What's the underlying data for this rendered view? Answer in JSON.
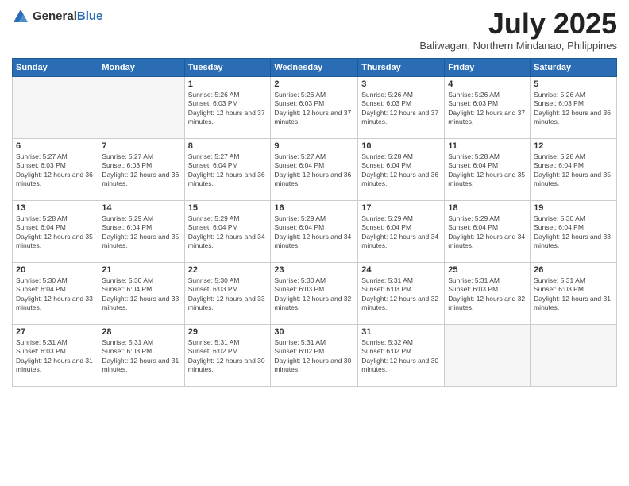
{
  "logo": {
    "general": "General",
    "blue": "Blue"
  },
  "title": {
    "month_year": "July 2025",
    "location": "Baliwagan, Northern Mindanao, Philippines"
  },
  "headers": [
    "Sunday",
    "Monday",
    "Tuesday",
    "Wednesday",
    "Thursday",
    "Friday",
    "Saturday"
  ],
  "weeks": [
    [
      {
        "num": "",
        "info": ""
      },
      {
        "num": "",
        "info": ""
      },
      {
        "num": "1",
        "info": "Sunrise: 5:26 AM\nSunset: 6:03 PM\nDaylight: 12 hours and 37 minutes."
      },
      {
        "num": "2",
        "info": "Sunrise: 5:26 AM\nSunset: 6:03 PM\nDaylight: 12 hours and 37 minutes."
      },
      {
        "num": "3",
        "info": "Sunrise: 5:26 AM\nSunset: 6:03 PM\nDaylight: 12 hours and 37 minutes."
      },
      {
        "num": "4",
        "info": "Sunrise: 5:26 AM\nSunset: 6:03 PM\nDaylight: 12 hours and 37 minutes."
      },
      {
        "num": "5",
        "info": "Sunrise: 5:26 AM\nSunset: 6:03 PM\nDaylight: 12 hours and 36 minutes."
      }
    ],
    [
      {
        "num": "6",
        "info": "Sunrise: 5:27 AM\nSunset: 6:03 PM\nDaylight: 12 hours and 36 minutes."
      },
      {
        "num": "7",
        "info": "Sunrise: 5:27 AM\nSunset: 6:03 PM\nDaylight: 12 hours and 36 minutes."
      },
      {
        "num": "8",
        "info": "Sunrise: 5:27 AM\nSunset: 6:04 PM\nDaylight: 12 hours and 36 minutes."
      },
      {
        "num": "9",
        "info": "Sunrise: 5:27 AM\nSunset: 6:04 PM\nDaylight: 12 hours and 36 minutes."
      },
      {
        "num": "10",
        "info": "Sunrise: 5:28 AM\nSunset: 6:04 PM\nDaylight: 12 hours and 36 minutes."
      },
      {
        "num": "11",
        "info": "Sunrise: 5:28 AM\nSunset: 6:04 PM\nDaylight: 12 hours and 35 minutes."
      },
      {
        "num": "12",
        "info": "Sunrise: 5:28 AM\nSunset: 6:04 PM\nDaylight: 12 hours and 35 minutes."
      }
    ],
    [
      {
        "num": "13",
        "info": "Sunrise: 5:28 AM\nSunset: 6:04 PM\nDaylight: 12 hours and 35 minutes."
      },
      {
        "num": "14",
        "info": "Sunrise: 5:29 AM\nSunset: 6:04 PM\nDaylight: 12 hours and 35 minutes."
      },
      {
        "num": "15",
        "info": "Sunrise: 5:29 AM\nSunset: 6:04 PM\nDaylight: 12 hours and 34 minutes."
      },
      {
        "num": "16",
        "info": "Sunrise: 5:29 AM\nSunset: 6:04 PM\nDaylight: 12 hours and 34 minutes."
      },
      {
        "num": "17",
        "info": "Sunrise: 5:29 AM\nSunset: 6:04 PM\nDaylight: 12 hours and 34 minutes."
      },
      {
        "num": "18",
        "info": "Sunrise: 5:29 AM\nSunset: 6:04 PM\nDaylight: 12 hours and 34 minutes."
      },
      {
        "num": "19",
        "info": "Sunrise: 5:30 AM\nSunset: 6:04 PM\nDaylight: 12 hours and 33 minutes."
      }
    ],
    [
      {
        "num": "20",
        "info": "Sunrise: 5:30 AM\nSunset: 6:04 PM\nDaylight: 12 hours and 33 minutes."
      },
      {
        "num": "21",
        "info": "Sunrise: 5:30 AM\nSunset: 6:04 PM\nDaylight: 12 hours and 33 minutes."
      },
      {
        "num": "22",
        "info": "Sunrise: 5:30 AM\nSunset: 6:03 PM\nDaylight: 12 hours and 33 minutes."
      },
      {
        "num": "23",
        "info": "Sunrise: 5:30 AM\nSunset: 6:03 PM\nDaylight: 12 hours and 32 minutes."
      },
      {
        "num": "24",
        "info": "Sunrise: 5:31 AM\nSunset: 6:03 PM\nDaylight: 12 hours and 32 minutes."
      },
      {
        "num": "25",
        "info": "Sunrise: 5:31 AM\nSunset: 6:03 PM\nDaylight: 12 hours and 32 minutes."
      },
      {
        "num": "26",
        "info": "Sunrise: 5:31 AM\nSunset: 6:03 PM\nDaylight: 12 hours and 31 minutes."
      }
    ],
    [
      {
        "num": "27",
        "info": "Sunrise: 5:31 AM\nSunset: 6:03 PM\nDaylight: 12 hours and 31 minutes."
      },
      {
        "num": "28",
        "info": "Sunrise: 5:31 AM\nSunset: 6:03 PM\nDaylight: 12 hours and 31 minutes."
      },
      {
        "num": "29",
        "info": "Sunrise: 5:31 AM\nSunset: 6:02 PM\nDaylight: 12 hours and 30 minutes."
      },
      {
        "num": "30",
        "info": "Sunrise: 5:31 AM\nSunset: 6:02 PM\nDaylight: 12 hours and 30 minutes."
      },
      {
        "num": "31",
        "info": "Sunrise: 5:32 AM\nSunset: 6:02 PM\nDaylight: 12 hours and 30 minutes."
      },
      {
        "num": "",
        "info": ""
      },
      {
        "num": "",
        "info": ""
      }
    ]
  ]
}
